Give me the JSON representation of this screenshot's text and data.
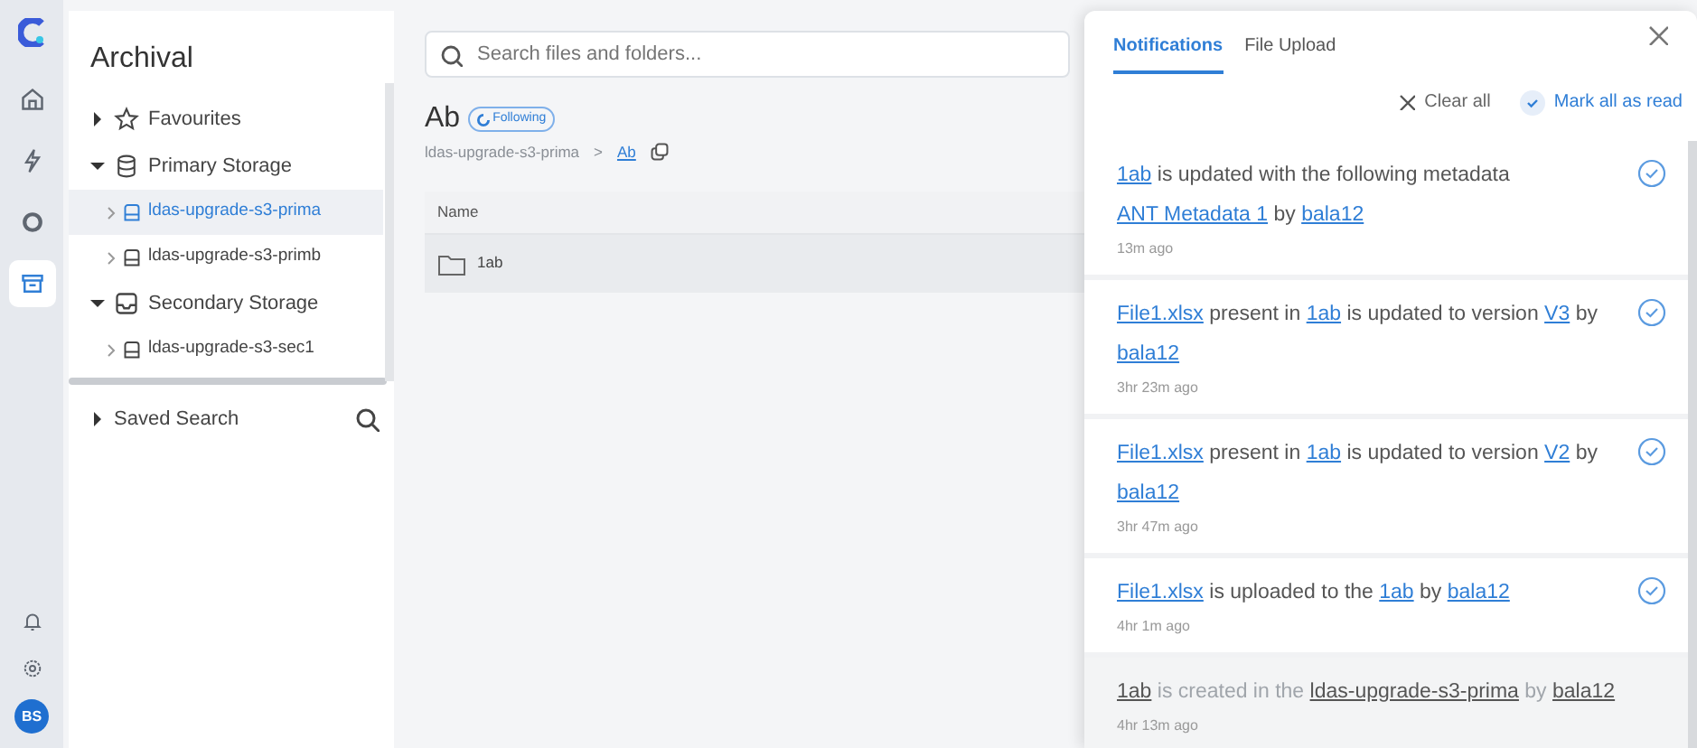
{
  "rail": {
    "items": [
      {
        "selected": false
      },
      {
        "selected": false
      },
      {
        "selected": false
      },
      {
        "selected": true
      }
    ],
    "avatar": "BS"
  },
  "sidebar": {
    "title": "Archival",
    "tree": [
      {
        "label": "Favourites",
        "expanded": false,
        "selected": false
      },
      {
        "label": "Primary Storage",
        "expanded": true,
        "selected": false,
        "children": [
          {
            "label": "ldas-upgrade-s3-prima",
            "expanded": false,
            "selected": true
          },
          {
            "label": "ldas-upgrade-s3-primb",
            "expanded": false,
            "selected": false
          }
        ]
      },
      {
        "label": "Secondary Storage",
        "expanded": true,
        "selected": false,
        "children": [
          {
            "label": "ldas-upgrade-s3-sec1",
            "expanded": false,
            "selected": false
          }
        ]
      }
    ],
    "saved_search": {
      "label": "Saved Search",
      "expanded": false
    }
  },
  "main": {
    "search": {
      "placeholder": "Search files and folders..."
    },
    "title": "Ab",
    "badge": "Following",
    "breadcrumb": [
      {
        "label": "ldas-upgrade-s3-prima",
        "current": false
      },
      {
        "label": "Ab",
        "current": true
      }
    ],
    "breadcrumb_separator": ">",
    "table": {
      "columns": [
        "Name"
      ],
      "rows": [
        {
          "name": "1ab",
          "kind": "folder"
        }
      ]
    }
  },
  "notifications": {
    "tabs": [
      {
        "label": "Notifications",
        "selected": true
      },
      {
        "label": "File Upload",
        "selected": false
      }
    ],
    "clear_all": "Clear all",
    "mark_all": "Mark all as read",
    "items": [
      {
        "read": false,
        "time": "13m ago",
        "segments": [
          {
            "text": "1ab",
            "link": true
          },
          {
            "text": " is updated with the following metadata ",
            "link": false
          },
          {
            "text": "ANT Metadata 1",
            "link": true
          },
          {
            "text": " by ",
            "link": false
          },
          {
            "text": "bala12",
            "link": true
          }
        ]
      },
      {
        "read": false,
        "time": "3hr 23m ago",
        "segments": [
          {
            "text": "File1.xlsx",
            "link": true
          },
          {
            "text": " present in ",
            "link": false
          },
          {
            "text": "1ab",
            "link": true
          },
          {
            "text": " is updated to version ",
            "link": false
          },
          {
            "text": "V3",
            "link": true
          },
          {
            "text": " by ",
            "link": false
          },
          {
            "text": "bala12",
            "link": true
          }
        ]
      },
      {
        "read": false,
        "time": "3hr 47m ago",
        "segments": [
          {
            "text": "File1.xlsx",
            "link": true
          },
          {
            "text": " present in ",
            "link": false
          },
          {
            "text": "1ab",
            "link": true
          },
          {
            "text": " is updated to version ",
            "link": false
          },
          {
            "text": "V2",
            "link": true
          },
          {
            "text": " by ",
            "link": false
          },
          {
            "text": "bala12",
            "link": true
          }
        ]
      },
      {
        "read": false,
        "time": "4hr 1m ago",
        "segments": [
          {
            "text": "File1.xlsx",
            "link": true
          },
          {
            "text": " is uploaded to the ",
            "link": false
          },
          {
            "text": "1ab",
            "link": true
          },
          {
            "text": " by ",
            "link": false
          },
          {
            "text": "bala12",
            "link": true
          }
        ]
      },
      {
        "read": true,
        "time": "4hr 13m ago",
        "segments": [
          {
            "text": "1ab",
            "link": true
          },
          {
            "text": " is created in the ",
            "link": false
          },
          {
            "text": "ldas-upgrade-s3-prima",
            "link": true
          },
          {
            "text": " by ",
            "link": false
          },
          {
            "text": "bala12",
            "link": true
          }
        ]
      }
    ]
  }
}
